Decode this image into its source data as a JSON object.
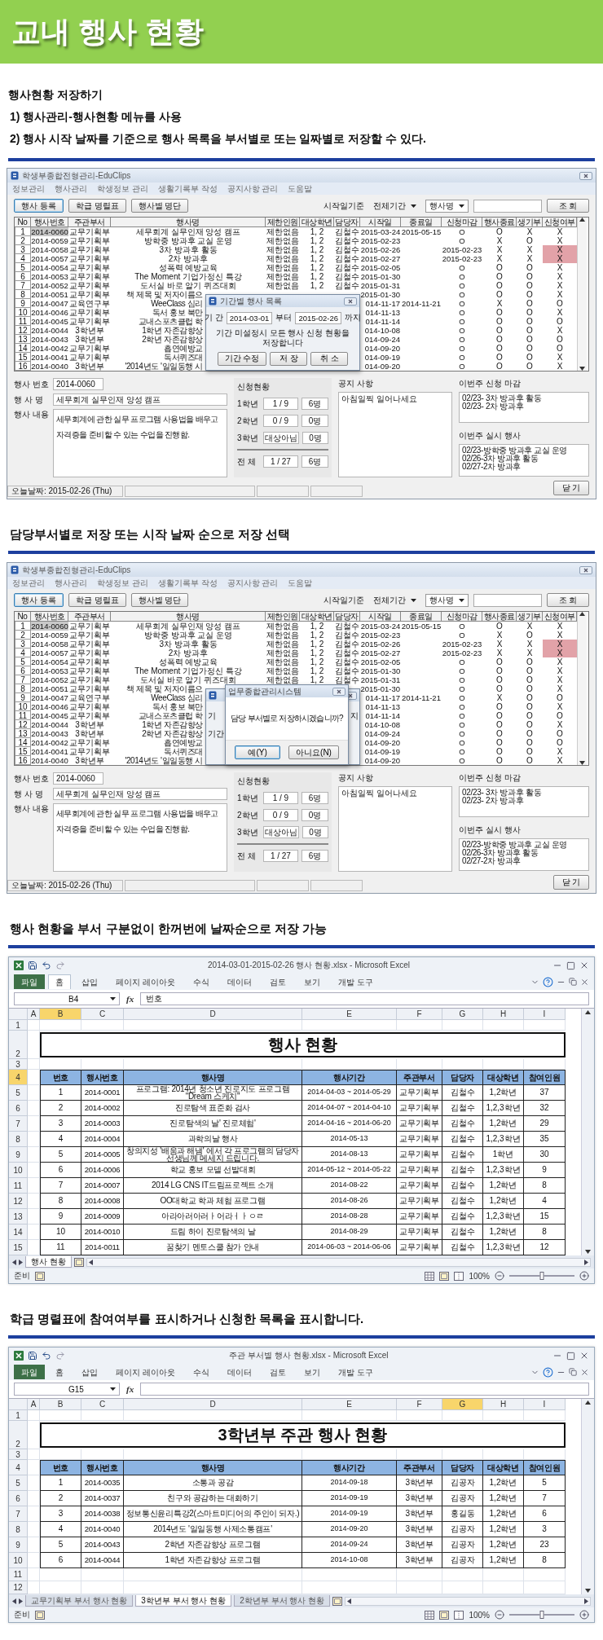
{
  "banner": {
    "title": "교내 행사 현황"
  },
  "intro": {
    "heading": "행사현황 저장하기",
    "steps": [
      "1) 행사관리-행사현황 메뉴를 사용",
      "2) 행사 시작 날짜를 기준으로 행사 목록을 부서별로 또는 일짜별로 저장할 수 있다."
    ]
  },
  "sections": [
    {
      "kind": "app",
      "window_title": "학생부종합전형관리-EduClips",
      "menu": [
        "정보관리",
        "행사관리",
        "학생정보 관리",
        "생활기록부 작성",
        "공지사항 관리",
        "도움말"
      ],
      "toolbar_buttons": [
        {
          "label": "행사 등록",
          "focused": true
        },
        {
          "label": "학급 명렬표",
          "focused": false
        },
        {
          "label": "행사별 명단",
          "focused": false
        }
      ],
      "filter_label": "시작일기준",
      "period_select": "전체기간",
      "field_select": "행사명",
      "search_button": "조 회",
      "columns": [
        "No",
        "행사번호",
        "주관부서",
        "행사명",
        "제한인원",
        "대상학년",
        "담당자",
        "시작일",
        "종료일",
        "신청마감",
        "행사종료",
        "생기부",
        "신청여부"
      ],
      "rows": [
        {
          "cells": [
            "1",
            "2014-0060",
            "교무기획부",
            "세무회계 실무인재 양성 캠프",
            "제한없음",
            "1, 2",
            "김철수",
            "2015-03-24",
            "2015-05-15",
            "O",
            "O",
            "X",
            "X"
          ],
          "selected": true,
          "alert": false
        },
        {
          "cells": [
            "2",
            "2014-0059",
            "교무기획부",
            "방학중 방과후 교실 운영",
            "제한없음",
            "1, 2",
            "김철수",
            "2015-02-23",
            null,
            "O",
            "X",
            "O",
            "X"
          ],
          "selected": false,
          "alert": false
        },
        {
          "cells": [
            "3",
            "2014-0058",
            "교무기획부",
            "3차 방과후 활동",
            "제한없음",
            "1, 2",
            "김철수",
            "2015-02-26",
            null,
            "2015-02-23",
            "X",
            "X",
            "X"
          ],
          "selected": false,
          "alert": true
        },
        {
          "cells": [
            "4",
            "2014-0057",
            "교무기획부",
            "2차 방과후",
            "제한없음",
            "1, 2",
            "김철수",
            "2015-02-27",
            null,
            "2015-02-23",
            "X",
            "X",
            "X"
          ],
          "selected": false,
          "alert": true
        },
        {
          "cells": [
            "5",
            "2014-0054",
            "교무기획부",
            "성폭력 예방교육",
            "제한없음",
            "1, 2",
            "김철수",
            "2015-02-05",
            null,
            "O",
            "O",
            "O",
            "X"
          ],
          "selected": false,
          "alert": false
        },
        {
          "cells": [
            "6",
            "2014-0053",
            "교무기획부",
            "The Moment 기업가정신 특강",
            "제한없음",
            "1, 2",
            "김철수",
            "2015-01-30",
            null,
            "O",
            "O",
            "O",
            "X"
          ],
          "selected": false,
          "alert": false
        },
        {
          "cells": [
            "7",
            "2014-0052",
            "교무기획부",
            "도서실 바로 알기 퀴즈대회",
            "제한없음",
            "1, 2",
            "김철수",
            "2015-01-31",
            null,
            "O",
            "O",
            "O",
            "X"
          ],
          "selected": false,
          "alert": false
        },
        {
          "cells": [
            "8",
            "2014-0051",
            "교무기획부",
            "책 제목 및 저자이름으",
            null,
            null,
            null,
            "2015-01-30",
            null,
            "O",
            "O",
            "O",
            "X"
          ],
          "selected": false,
          "alert": false
        },
        {
          "cells": [
            "9",
            "2014-0047",
            "교육연구부",
            "WeeClass 심리",
            null,
            null,
            null,
            "014-11-17",
            "2014-11-21",
            "O",
            "X",
            "O",
            "O"
          ],
          "selected": false,
          "alert": false
        },
        {
          "cells": [
            "10",
            "2014-0046",
            "교무기획부",
            "독서 홍보 북만",
            null,
            null,
            null,
            "014-11-13",
            null,
            "O",
            "O",
            "O",
            "X"
          ],
          "selected": false,
          "alert": false
        },
        {
          "cells": [
            "11",
            "2014-0045",
            "교무기획부",
            "교내스포츠클럽 학",
            null,
            null,
            null,
            "014-11-14",
            null,
            "O",
            "O",
            "O",
            "O"
          ],
          "selected": false,
          "alert": false
        },
        {
          "cells": [
            "12",
            "2014-0044",
            "3학년부",
            "1학년 자존감향상",
            null,
            null,
            null,
            "014-10-08",
            null,
            "O",
            "O",
            "O",
            "X"
          ],
          "selected": false,
          "alert": false
        },
        {
          "cells": [
            "13",
            "2014-0043",
            "3학년부",
            "2학년 자존감향상",
            null,
            null,
            null,
            "014-09-24",
            null,
            "O",
            "O",
            "O",
            "O"
          ],
          "selected": false,
          "alert": false
        },
        {
          "cells": [
            "14",
            "2014-0042",
            "교무기획부",
            "흡연예방교",
            null,
            null,
            null,
            "014-09-20",
            null,
            "O",
            "O",
            "O",
            "O"
          ],
          "selected": false,
          "alert": false
        },
        {
          "cells": [
            "15",
            "2014-0041",
            "교무기획부",
            "독서퀴즈대",
            null,
            null,
            null,
            "014-09-19",
            null,
            "O",
            "O",
            "O",
            "X"
          ],
          "selected": false,
          "alert": false
        },
        {
          "cells": [
            "16",
            "2014-0040",
            "3학년부",
            "'2014년도 '일일동행 시",
            null,
            null,
            null,
            "014-09-20",
            null,
            "O",
            "O",
            "O",
            "X"
          ],
          "selected": false,
          "alert": false
        }
      ],
      "dialogs": [
        {
          "kind": "period",
          "title": "기간별 행사 목록",
          "period_label": "기 간",
          "from": "2014-03-01",
          "from_suffix": "부터",
          "to": "2015-02-26",
          "to_suffix": "까지",
          "message": "기간 미설정시 모든 행사 신청 현황을 저장합니다",
          "buttons": [
            "기간 수정",
            "저 장",
            "취 소"
          ]
        }
      ],
      "detail": {
        "number_label": "행사 번호",
        "number": "2014-0060",
        "name_label": "행 사 명",
        "name": "세무회계 실무인재 양성 캠프",
        "content_label": "행사 내용",
        "content_lines": [
          "세무회계에 관한 실무 프로그램 사용법을 배우고",
          "자격증을 준비할 수 있는 수업을 진행함."
        ]
      },
      "applications": {
        "title": "신청현황",
        "rows": [
          {
            "label": "1학년",
            "ratio": "1 / 9",
            "count": "6명"
          },
          {
            "label": "2학년",
            "ratio": "0 / 9",
            "count": "0명"
          },
          {
            "label": "3학년",
            "ratio": "대상아님",
            "count": "0명"
          }
        ],
        "total": {
          "label": "전  체",
          "ratio": "1 / 27",
          "count": "6명"
        }
      },
      "notice": {
        "title": "공지 사항",
        "text": "아침일찍 일어나세요"
      },
      "deadlines": {
        "title": "이번주 신청 마감",
        "items": [
          "02/23- 3차 방과후 활동",
          "02/23- 2차 방과후"
        ]
      },
      "events": {
        "title": "이번주 실시 행사",
        "items": [
          "02/23-방학중 방과후 교실 운영",
          "02/26-3차 방과후 활동",
          "02/27-2차 방과후"
        ]
      },
      "close_button": "닫  기",
      "status": "오늘날짜: 2015-02-26 (Thu)"
    },
    {
      "kind": "app",
      "heading": "담당부서별로 저장 또는 시작 날짜 순으로 저장 선택",
      "window_title": "학생부종합전형관리-EduClips",
      "menu": [
        "정보관리",
        "행사관리",
        "학생정보 관리",
        "생활기록부 작성",
        "공지사항 관리",
        "도움말"
      ],
      "toolbar_buttons": [
        {
          "label": "행사 등록",
          "focused": true
        },
        {
          "label": "학급 명렬표",
          "focused": false
        },
        {
          "label": "행사별 명단",
          "focused": false
        }
      ],
      "filter_label": "시작일기준",
      "period_select": "전체기간",
      "field_select": "행사명",
      "search_button": "조 회",
      "columns": [
        "No",
        "행사번호",
        "주관부서",
        "행사명",
        "제한인원",
        "대상학년",
        "담당자",
        "시작일",
        "종료일",
        "신청마감",
        "행사종료",
        "생기부",
        "신청여부"
      ],
      "rows": [
        {
          "cells": [
            "1",
            "2014-0060",
            "교무기획부",
            "세무회계 실무인재 양성 캠프",
            "제한없음",
            "1, 2",
            "김철수",
            "2015-03-24",
            "2015-05-15",
            "O",
            "O",
            "X",
            "X"
          ],
          "selected": true,
          "alert": false
        },
        {
          "cells": [
            "2",
            "2014-0059",
            "교무기획부",
            "방학중 방과후 교실 운영",
            "제한없음",
            "1, 2",
            "김철수",
            "2015-02-23",
            null,
            "O",
            "X",
            "O",
            "X"
          ],
          "selected": false,
          "alert": false
        },
        {
          "cells": [
            "3",
            "2014-0058",
            "교무기획부",
            "3차 방과후 활동",
            "제한없음",
            "1, 2",
            "김철수",
            "2015-02-26",
            null,
            "2015-02-23",
            "X",
            "X",
            "X"
          ],
          "selected": false,
          "alert": true
        },
        {
          "cells": [
            "4",
            "2014-0057",
            "교무기획부",
            "2차 방과후",
            "제한없음",
            "1, 2",
            "김철수",
            "2015-02-27",
            null,
            "2015-02-23",
            "X",
            "X",
            "X"
          ],
          "selected": false,
          "alert": true
        },
        {
          "cells": [
            "5",
            "2014-0054",
            "교무기획부",
            "성폭력 예방교육",
            "제한없음",
            "1, 2",
            "김철수",
            "2015-02-05",
            null,
            "O",
            "O",
            "O",
            "X"
          ],
          "selected": false,
          "alert": false
        },
        {
          "cells": [
            "6",
            "2014-0053",
            "교무기획부",
            "The Moment 기업가정신 특강",
            "제한없음",
            "1, 2",
            "김철수",
            "2015-01-30",
            null,
            "O",
            "O",
            "O",
            "X"
          ],
          "selected": false,
          "alert": false
        },
        {
          "cells": [
            "7",
            "2014-0052",
            "교무기획부",
            "도서실 바로 알기 퀴즈대회",
            "제한없음",
            "1, 2",
            "김철수",
            "2015-01-31",
            null,
            "O",
            "O",
            "O",
            "X"
          ],
          "selected": false,
          "alert": false
        },
        {
          "cells": [
            "8",
            "2014-0051",
            "교무기획부",
            "책 제목 및 저자이름으",
            null,
            null,
            null,
            "2015-01-30",
            null,
            "O",
            "O",
            "O",
            "X"
          ],
          "selected": false,
          "alert": false
        },
        {
          "cells": [
            "9",
            "2014-0047",
            "교육연구부",
            "WeeClass 심리",
            null,
            null,
            null,
            "014-11-17",
            "2014-11-21",
            "O",
            "X",
            "O",
            "O"
          ],
          "selected": false,
          "alert": false
        },
        {
          "cells": [
            "10",
            "2014-0046",
            "교무기획부",
            "독서 홍보 북만",
            null,
            null,
            null,
            "014-11-13",
            null,
            "O",
            "O",
            "O",
            "X"
          ],
          "selected": false,
          "alert": false
        },
        {
          "cells": [
            "11",
            "2014-0045",
            "교무기획부",
            "교내스포츠클럽 학",
            null,
            null,
            null,
            "014-11-14",
            null,
            "O",
            "O",
            "O",
            "O"
          ],
          "selected": false,
          "alert": false
        },
        {
          "cells": [
            "12",
            "2014-0044",
            "3학년부",
            "1학년 자존감향상",
            null,
            null,
            null,
            "014-10-08",
            null,
            "O",
            "O",
            "O",
            "X"
          ],
          "selected": false,
          "alert": false
        },
        {
          "cells": [
            "13",
            "2014-0043",
            "3학년부",
            "2학년 자존감향상",
            null,
            null,
            null,
            "014-09-24",
            null,
            "O",
            "O",
            "O",
            "O"
          ],
          "selected": false,
          "alert": false
        },
        {
          "cells": [
            "14",
            "2014-0042",
            "교무기획부",
            "흡연예방교",
            null,
            null,
            null,
            "014-09-20",
            null,
            "O",
            "O",
            "O",
            "O"
          ],
          "selected": false,
          "alert": false
        },
        {
          "cells": [
            "15",
            "2014-0041",
            "교무기획부",
            "독서퀴즈대",
            null,
            null,
            null,
            "014-09-19",
            null,
            "O",
            "O",
            "O",
            "X"
          ],
          "selected": false,
          "alert": false
        },
        {
          "cells": [
            "16",
            "2014-0040",
            "3학년부",
            "'2014년도 '일일동행 시",
            null,
            null,
            null,
            "014-09-20",
            null,
            "O",
            "O",
            "O",
            "X"
          ],
          "selected": false,
          "alert": false
        }
      ],
      "dialogs": [
        {
          "kind": "fragment",
          "texts": [
            "기",
            "지",
            "기간"
          ]
        },
        {
          "kind": "confirm",
          "title": "업무종합관리시스템",
          "message": "담당 부서별로 저장하시겠습니까?",
          "buttons": [
            {
              "label": "예(Y)",
              "focused": true
            },
            {
              "label": "아니요(N)",
              "focused": false
            }
          ]
        }
      ],
      "detail": {
        "number_label": "행사 번호",
        "number": "2014-0060",
        "name_label": "행 사 명",
        "name": "세무회계 실무인재 양성 캠프",
        "content_label": "행사 내용",
        "content_lines": [
          "세무회계에 관한 실무 프로그램 사용법을 배우고",
          "자격증을 준비할 수 있는 수업을 진행함."
        ]
      },
      "applications": {
        "title": "신청현황",
        "rows": [
          {
            "label": "1학년",
            "ratio": "1 / 9",
            "count": "6명"
          },
          {
            "label": "2학년",
            "ratio": "0 / 9",
            "count": "0명"
          },
          {
            "label": "3학년",
            "ratio": "대상아님",
            "count": "0명"
          }
        ],
        "total": {
          "label": "전  체",
          "ratio": "1 / 27",
          "count": "6명"
        }
      },
      "notice": {
        "title": "공지 사항",
        "text": "아침일찍 일어나세요"
      },
      "deadlines": {
        "title": "이번주 신청 마감",
        "items": [
          "02/23- 3차 방과후 활동",
          "02/23- 2차 방과후"
        ]
      },
      "events": {
        "title": "이번주 실시 행사",
        "items": [
          "02/23-방학중 방과후 교실 운영",
          "02/26-3차 방과후 활동",
          "02/27-2차 방과후"
        ]
      },
      "close_button": "닫  기",
      "status": "오늘날짜: 2015-02-26 (Thu)"
    },
    {
      "kind": "excel",
      "heading": "행사 현황을 부서 구분없이 한꺼번에 날짜순으로 저장 가능",
      "window_title": "2014-03-01-2015-02-26 행사 현황.xlsx  -  Microsoft Excel",
      "ribbon_tabs": [
        {
          "label": "파일",
          "selected": false
        },
        {
          "label": "홈",
          "selected": true
        },
        {
          "label": "삽입",
          "selected": false
        },
        {
          "label": "페이지 레이아웃",
          "selected": false
        },
        {
          "label": "수식",
          "selected": false
        },
        {
          "label": "데이터",
          "selected": false
        },
        {
          "label": "검토",
          "selected": false
        },
        {
          "label": "보기",
          "selected": false
        },
        {
          "label": "개발 도구",
          "selected": false
        }
      ],
      "name_box": "B4",
      "function_label": "fx",
      "formula": "번호",
      "columns": [
        {
          "label": "A",
          "selected": false
        },
        {
          "label": "B",
          "selected": true
        },
        {
          "label": "C",
          "selected": false
        },
        {
          "label": "D",
          "selected": false
        },
        {
          "label": "E",
          "selected": false
        },
        {
          "label": "F",
          "selected": false
        },
        {
          "label": "G",
          "selected": false
        },
        {
          "label": "H",
          "selected": false
        },
        {
          "label": "I",
          "selected": false
        }
      ],
      "row_headers": [
        {
          "label": "1",
          "selected": false
        },
        {
          "label": "2",
          "selected": false
        },
        {
          "label": "3",
          "selected": false
        },
        {
          "label": "4",
          "selected": true
        },
        {
          "label": "5",
          "selected": false
        },
        {
          "label": "6",
          "selected": false
        },
        {
          "label": "7",
          "selected": false
        },
        {
          "label": "8",
          "selected": false
        },
        {
          "label": "9",
          "selected": false
        },
        {
          "label": "10",
          "selected": false
        },
        {
          "label": "11",
          "selected": false
        },
        {
          "label": "12",
          "selected": false
        },
        {
          "label": "13",
          "selected": false
        },
        {
          "label": "14",
          "selected": false
        },
        {
          "label": "15",
          "selected": false
        }
      ],
      "sheet_title": "행사 현황",
      "headers": [
        "번호",
        "행사번호",
        "행사명",
        "행사기간",
        "주관부서",
        "담당자",
        "대상학년",
        "참여인원"
      ],
      "rows": [
        [
          "",
          "1",
          "2014-0001",
          "프로그램: 2014년 청소년 진로지도 프로그램 \"Dream 스케치\"",
          "2014-04-03 ~ 2014-05-29",
          "교무기획부",
          "김철수",
          "1,2학년",
          "37"
        ],
        [
          "",
          "2",
          "2014-0002",
          "진로탐색 표준화 검사",
          "2014-04-07 ~ 2014-04-10",
          "교무기획부",
          "김철수",
          "1,2,3학년",
          "32"
        ],
        [
          "",
          "3",
          "2014-0003",
          "진로탐색의 날'  진로체험'",
          "2014-04-16 ~ 2014-06-20",
          "교무기획부",
          "김철수",
          "1,2학년",
          "29"
        ],
        [
          "",
          "4",
          "2014-0004",
          "과학의날 행사",
          "2014-05-13",
          "교무기획부",
          "김철수",
          "1,2,3학년",
          "35"
        ],
        [
          "",
          "5",
          "2014-0005",
          "창의지성 '배움과 해냄' 에서 각 프로그램의 담당자 선생님께 메세지 드립니다.",
          "2014-08-13",
          "교무기획부",
          "김철수",
          "1학년",
          "30"
        ],
        [
          "",
          "6",
          "2014-0006",
          "학교 홍보 모델 선발대회",
          "2014-05-12 ~ 2014-05-22",
          "교무기획부",
          "김철수",
          "1,2,3학년",
          "9"
        ],
        [
          "",
          "7",
          "2014-0007",
          "2014 LG CNS IT드림프로젝트 소개",
          "2014-08-22",
          "교무기획부",
          "김철수",
          "1,2학년",
          "8"
        ],
        [
          "",
          "8",
          "2014-0008",
          "OO대학교 학과 체험 프로그램",
          "2014-08-26",
          "교무기획부",
          "김철수",
          "1,2학년",
          "4"
        ],
        [
          "",
          "9",
          "2014-0009",
          "아라아러아러ㅏ어라ㅓㅏㅇㄹ",
          "2014-08-28",
          "교무기획부",
          "김철수",
          "1,2,3학년",
          "15"
        ],
        [
          "",
          "10",
          "2014-0010",
          "드림 하이 진로탐색의 날",
          "2014-08-29",
          "교무기획부",
          "김철수",
          "1,2학년",
          "8"
        ],
        [
          "",
          "11",
          "2014-0011",
          "꿈찾기 멘토스쿨 참가 안내",
          "2014-06-03 ~ 2014-06-06",
          "교무기획부",
          "김철수",
          "1,2,3학년",
          "12"
        ]
      ],
      "sheet_tabs": [
        {
          "label": "행사 현황",
          "selected": true
        }
      ],
      "status": "준비",
      "zoom": "100%",
      "zoom_slider": {
        "level": 0.5
      }
    },
    {
      "kind": "excel",
      "heading": "학급 명렬표에 참여여부를 표시하거나 신청한 목록을 표시합니다.",
      "window_title": "주관 부서별 행사 현황.xlsx  -  Microsoft Excel",
      "ribbon_tabs": [
        {
          "label": "파일",
          "selected": false
        },
        {
          "label": "홈",
          "selected": false
        },
        {
          "label": "삽입",
          "selected": false
        },
        {
          "label": "페이지 레이아웃",
          "selected": false
        },
        {
          "label": "수식",
          "selected": false
        },
        {
          "label": "데이터",
          "selected": false
        },
        {
          "label": "검토",
          "selected": false
        },
        {
          "label": "보기",
          "selected": false
        },
        {
          "label": "개발 도구",
          "selected": false
        }
      ],
      "name_box": "G15",
      "function_label": "fx",
      "columns": [
        {
          "label": "A",
          "selected": false
        },
        {
          "label": "B",
          "selected": false
        },
        {
          "label": "C",
          "selected": false
        },
        {
          "label": "D",
          "selected": false
        },
        {
          "label": "E",
          "selected": false
        },
        {
          "label": "F",
          "selected": false
        },
        {
          "label": "G",
          "selected": true
        },
        {
          "label": "H",
          "selected": false
        },
        {
          "label": "I",
          "selected": false
        }
      ],
      "row_headers": [
        {
          "label": "1",
          "selected": false
        },
        {
          "label": "2",
          "selected": false
        },
        {
          "label": "3",
          "selected": false
        },
        {
          "label": "4",
          "selected": false
        },
        {
          "label": "5",
          "selected": false
        },
        {
          "label": "6",
          "selected": false
        },
        {
          "label": "7",
          "selected": false
        },
        {
          "label": "8",
          "selected": false
        },
        {
          "label": "9",
          "selected": false
        },
        {
          "label": "10",
          "selected": false
        },
        {
          "label": "11",
          "selected": false
        },
        {
          "label": "12",
          "selected": false
        }
      ],
      "sheet_title": "3학년부 주관 행사 현황",
      "headers": [
        "번호",
        "행사번호",
        "행사명",
        "행사기간",
        "주관부서",
        "담당자",
        "대상학년",
        "참여인원"
      ],
      "rows": [
        [
          "",
          "1",
          "2014-0035",
          "소통과 공감",
          "2014-09-18",
          "3학년부",
          "김공자",
          "1,2학년",
          "5"
        ],
        [
          "",
          "2",
          "2014-0037",
          "친구와 공감하는 대화하기",
          "2014-09-19",
          "3학년부",
          "김공자",
          "1,2학년",
          "7"
        ],
        [
          "",
          "3",
          "2014-0038",
          "정보통신윤리특강2(스마트미디어의 주인이 되자.)",
          "2014-09-19",
          "3학년부",
          "홍길동",
          "1,2학년",
          "6"
        ],
        [
          "",
          "4",
          "2014-0040",
          "2014년도 '일일동행 사제소통캠프'",
          "2014-09-20",
          "3학년부",
          "김공자",
          "1,2학년",
          "3"
        ],
        [
          "",
          "5",
          "2014-0043",
          "2학년 자존감향상 프로그램",
          "2014-09-24",
          "3학년부",
          "김공자",
          "1,2학년",
          "23"
        ],
        [
          "",
          "6",
          "2014-0044",
          "1학년 자존감향상 프로그램",
          "2014-10-08",
          "3학년부",
          "김공자",
          "1,2학년",
          "8"
        ]
      ],
      "sheet_tabs": [
        {
          "label": "교무기획부 부서 행사 현황",
          "selected": false
        },
        {
          "label": "3학년부 부서 행사 현황",
          "selected": true
        },
        {
          "label": "2학년부 부서 행사 현황",
          "selected": false
        }
      ],
      "status": "준비",
      "zoom": "100%",
      "zoom_slider": {
        "level": 0.5
      }
    }
  ]
}
